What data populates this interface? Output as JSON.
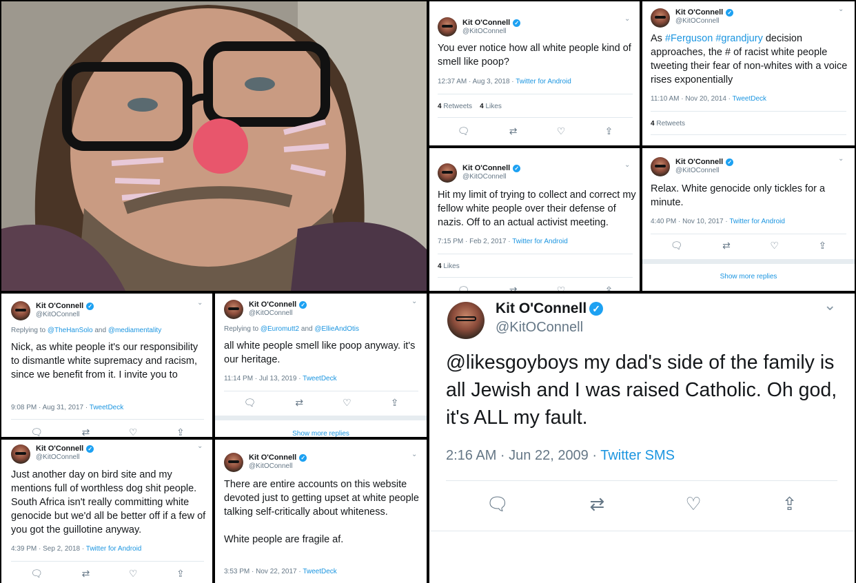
{
  "author": {
    "name": "Kit O'Connell",
    "handle": "@KitOConnell"
  },
  "icons": {
    "reply": "reply-icon",
    "retweet": "retweet-icon",
    "like": "like-icon",
    "share": "share-icon",
    "verified": "verified-badge-icon",
    "chevron": "chevron-down-icon"
  },
  "colors": {
    "link": "#1b95e0",
    "verified": "#1da1f2",
    "muted": "#657786"
  },
  "tweets": [
    {
      "text": "You ever notice how all white people kind of smell like poop?",
      "time": "12:37 AM · Aug 3, 2018 · ",
      "source": "Twitter for Android",
      "stats": [
        {
          "count": "4",
          "label": "Retweets"
        },
        {
          "count": "4",
          "label": "Likes"
        }
      ]
    },
    {
      "text_parts": [
        "As ",
        "#Ferguson",
        " ",
        "#grandjury",
        " decision approaches, the # of racist white people tweeting their fear of non-whites with a voice rises exponentially"
      ],
      "time": "11:10 AM · Nov 20, 2014 · ",
      "source": "TweetDeck",
      "stats": [
        {
          "count": "4",
          "label": "Retweets"
        }
      ]
    },
    {
      "text": "Hit my limit of trying to collect and correct my fellow white people over their defense of nazis. Off to an actual activist meeting.",
      "time": "7:15 PM · Feb 2, 2017 · ",
      "source": "Twitter for Android",
      "stats": [
        {
          "count": "4",
          "label": "Likes"
        }
      ]
    },
    {
      "text": "Relax. White genocide only tickles for a minute.",
      "time": "4:40 PM · Nov 10, 2017 · ",
      "source": "Twitter for Android",
      "show_more": "Show more replies"
    },
    {
      "reply_prefix": "Replying to ",
      "reply_a": "@TheHanSolo",
      "reply_and": " and ",
      "reply_b": "@mediamentality",
      "text": "Nick, as white people it's our responsibility to dismantle white supremacy and racism, since we benefit from it. I invite you to",
      "time": "9:08 PM · Aug 31, 2017 · ",
      "source": "TweetDeck"
    },
    {
      "reply_prefix": "Replying to ",
      "reply_a": "@Euromutt2",
      "reply_and": " and ",
      "reply_b": "@EllieAndOtis",
      "text": "all white people smell like poop anyway. it's our heritage.",
      "time": "11:14 PM · Jul 13, 2019 · ",
      "source": "TweetDeck",
      "show_more": "Show more replies"
    },
    {
      "text": "Just another day on bird site and my mentions full of worthless dog shit people. South Africa isn't really committing white genocide but we'd all be better off if a few of you got the guillotine anyway.",
      "time": "4:39 PM · Sep 2, 2018 · ",
      "source": "Twitter for Android"
    },
    {
      "text": "There are entire accounts on this website devoted just to getting upset at white people talking self-critically about whiteness.\n\nWhite people are fragile af.",
      "time": "3:53 PM · Nov 22, 2017 · ",
      "source": "TweetDeck"
    },
    {
      "text": "@likesgoyboys my dad's side of the family is all Jewish and I was raised Catholic. Oh god, it's ALL my fault.",
      "time": "2:16 AM · Jun 22, 2009 · ",
      "source": "Twitter SMS"
    }
  ]
}
